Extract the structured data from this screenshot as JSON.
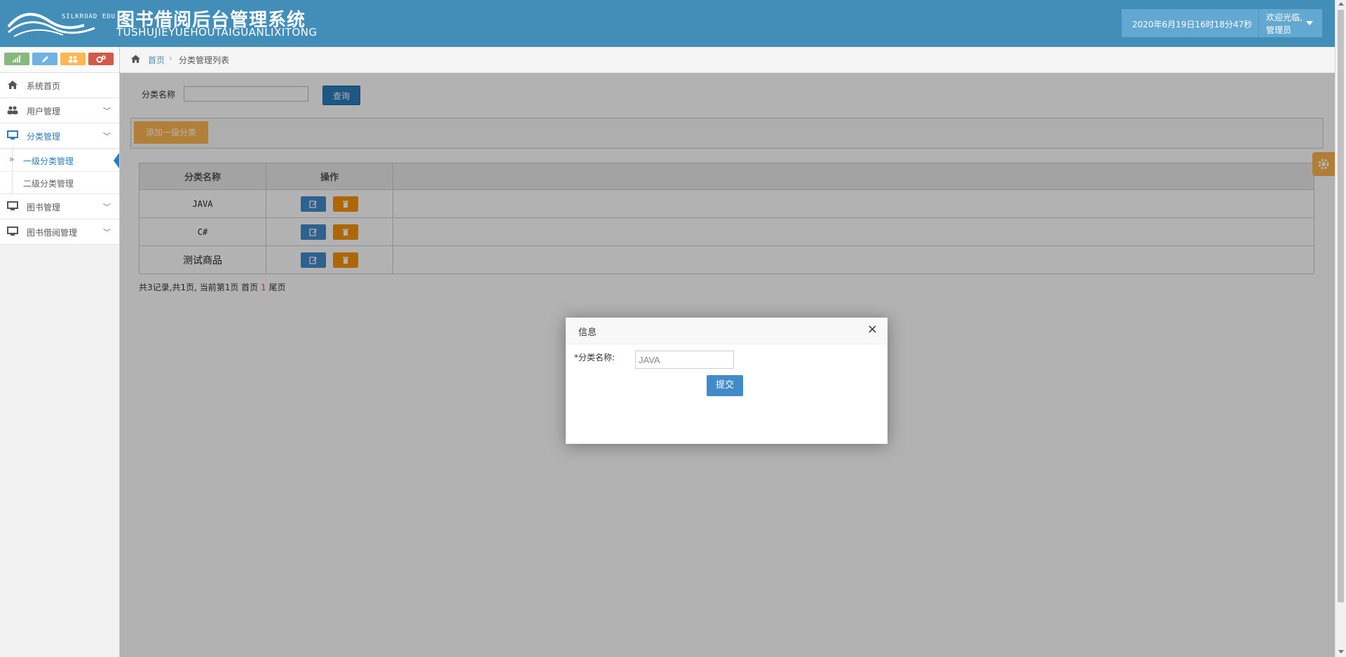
{
  "header": {
    "logo_edu": "SILKROAD EDU",
    "title": "图书借阅后台管理系统",
    "subtitle": "TUSHUJIEYUEHOUTAIGUANLIXITONG",
    "datetime": "2020年6月19日16时18分47秒",
    "welcome": "欢迎光临,",
    "role": "管理员"
  },
  "sidebar": {
    "items": [
      {
        "label": "系统首页",
        "icon": "home-icon"
      },
      {
        "label": "用户管理",
        "icon": "users-icon"
      },
      {
        "label": "分类管理",
        "icon": "desktop-icon"
      },
      {
        "label": "图书管理",
        "icon": "desktop-icon"
      },
      {
        "label": "图书借阅管理",
        "icon": "desktop-icon"
      }
    ],
    "submenu": [
      {
        "label": "一级分类管理"
      },
      {
        "label": "二级分类管理"
      }
    ]
  },
  "breadcrumb": {
    "home": "首页",
    "current": "分类管理列表"
  },
  "search": {
    "label": "分类名称",
    "value": "",
    "button": "查询"
  },
  "toolbar": {
    "add_button": "添加一级分类"
  },
  "table": {
    "columns": [
      "分类名称",
      "操作"
    ],
    "rows": [
      {
        "name": "JAVA"
      },
      {
        "name": "C#"
      },
      {
        "name": "测试商品"
      }
    ]
  },
  "pager": {
    "prefix": "共3记录,共1页, 当前第1页 首页",
    "current": "1",
    "suffix": "尾页"
  },
  "modal": {
    "title": "信息",
    "close": "×",
    "field_label": "*分类名称:",
    "field_value": "JAVA",
    "submit": "提交"
  },
  "colors": {
    "header_bg": "#438eb9",
    "primary": "#428bca",
    "warning": "#ffb752",
    "active_text": "#2b7dbc"
  }
}
